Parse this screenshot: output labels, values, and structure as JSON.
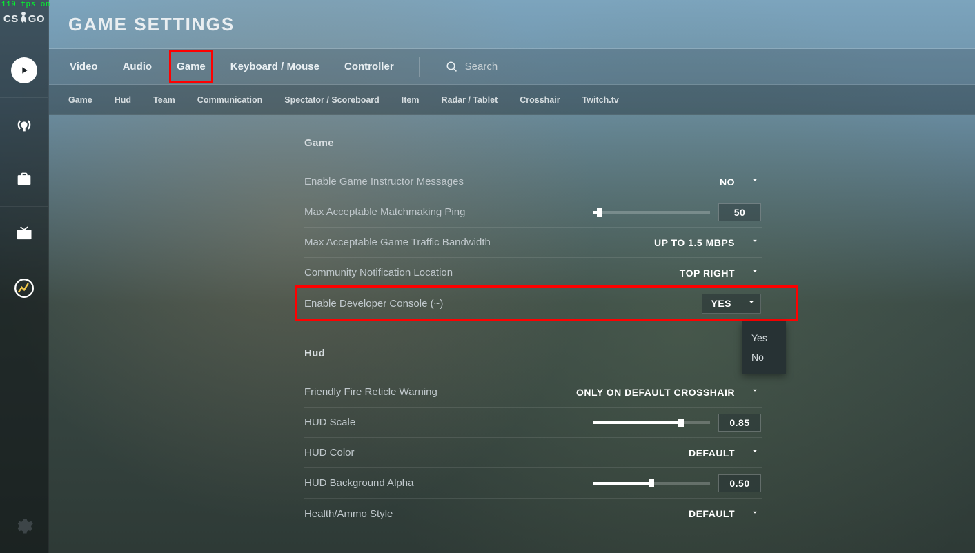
{
  "fps_overlay": "119 fps on",
  "logo": {
    "left": "CS",
    "right": "GO"
  },
  "page_title": "GAME SETTINGS",
  "tabs_main": [
    {
      "id": "video",
      "label": "Video"
    },
    {
      "id": "audio",
      "label": "Audio"
    },
    {
      "id": "game",
      "label": "Game",
      "active": true
    },
    {
      "id": "keyboard",
      "label": "Keyboard / Mouse"
    },
    {
      "id": "controller",
      "label": "Controller"
    }
  ],
  "search_label": "Search",
  "tabs_sub": [
    {
      "id": "game",
      "label": "Game"
    },
    {
      "id": "hud",
      "label": "Hud"
    },
    {
      "id": "team",
      "label": "Team"
    },
    {
      "id": "communication",
      "label": "Communication"
    },
    {
      "id": "spectator",
      "label": "Spectator / Scoreboard"
    },
    {
      "id": "item",
      "label": "Item"
    },
    {
      "id": "radar",
      "label": "Radar / Tablet"
    },
    {
      "id": "crosshair",
      "label": "Crosshair"
    },
    {
      "id": "twitch",
      "label": "Twitch.tv"
    }
  ],
  "sections": {
    "game": {
      "title": "Game",
      "rows": {
        "instructor": {
          "label": "Enable Game Instructor Messages",
          "value": "NO"
        },
        "ping": {
          "label": "Max Acceptable Matchmaking Ping",
          "value": "50",
          "slider_pct": 6
        },
        "bandwidth": {
          "label": "Max Acceptable Game Traffic Bandwidth",
          "value": "UP TO 1.5 MBPS"
        },
        "community": {
          "label": "Community Notification Location",
          "value": "TOP RIGHT"
        },
        "devconsole": {
          "label": "Enable Developer Console (~)",
          "value": "YES",
          "options": [
            "Yes",
            "No"
          ]
        }
      }
    },
    "hud": {
      "title": "Hud",
      "rows": {
        "friendlyfire": {
          "label": "Friendly Fire Reticle Warning",
          "value": "ONLY ON DEFAULT CROSSHAIR"
        },
        "hudscale": {
          "label": "HUD Scale",
          "value": "0.85",
          "slider_pct": 75
        },
        "hudcolor": {
          "label": "HUD Color",
          "value": "DEFAULT"
        },
        "hudalpha": {
          "label": "HUD Background Alpha",
          "value": "0.50",
          "slider_pct": 50
        },
        "healthammo": {
          "label": "Health/Ammo Style",
          "value": "DEFAULT"
        }
      }
    }
  },
  "sidebar_icons": [
    "play",
    "broadcast",
    "inventory",
    "tv",
    "stats",
    "settings"
  ]
}
